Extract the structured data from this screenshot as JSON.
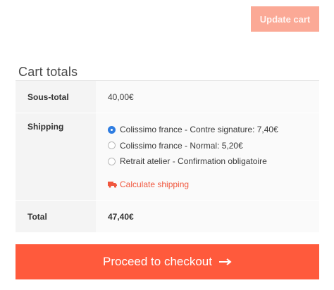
{
  "update_cart": {
    "label": "Update cart"
  },
  "cart_totals": {
    "title": "Cart totals",
    "subtotal": {
      "label": "Sous-total",
      "value": "40,00€"
    },
    "shipping": {
      "label": "Shipping",
      "options": [
        {
          "label": "Colissimo france - Contre signature: 7,40€",
          "checked": true
        },
        {
          "label": "Colissimo france - Normal: 5,20€",
          "checked": false
        },
        {
          "label": "Retrait atelier - Confirmation obligatoire",
          "checked": false
        }
      ],
      "calculate_label": "Calculate shipping",
      "calculate_icon": "truck-icon"
    },
    "total": {
      "label": "Total",
      "value": "47,40€"
    }
  },
  "checkout": {
    "label": "Proceed to checkout",
    "icon": "arrow-right-icon"
  },
  "colors": {
    "accent": "#ff5a3c",
    "update_button": "#fba996",
    "radio_selected": "#2f7de1"
  }
}
